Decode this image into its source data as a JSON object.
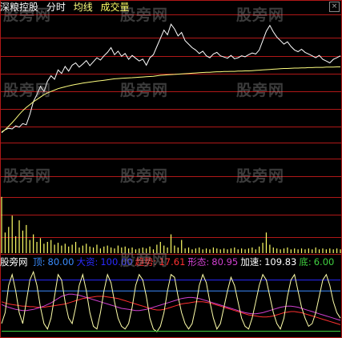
{
  "header": {
    "indicator_name": "深粮控股",
    "mode": "分时",
    "avg_label": "均线",
    "vol_label": "成交量"
  },
  "indicator": {
    "name": "股旁网",
    "items": [
      {
        "label": "顶:",
        "value": "80.00",
        "color": "#3a8cff"
      },
      {
        "label": "大资:",
        "value": "100.00",
        "color": "#2a2aff"
      },
      {
        "label": "趋势:",
        "value": "17.61",
        "color": "#ff3030"
      },
      {
        "label": "形态:",
        "value": "80.95",
        "color": "#d040d0"
      },
      {
        "label": "加速:",
        "value": "109.83",
        "color": "#ffffff"
      },
      {
        "label": "底:",
        "value": "6.00",
        "color": "#40d040"
      }
    ]
  },
  "watermark": "股旁网",
  "colors": {
    "price": "#ffffff",
    "avg": "#ffff80",
    "grid": "#b01818",
    "volume": "#ffff66",
    "topline": "#3a8cff",
    "bigline": "#2a2aff",
    "trend": "#ff3030",
    "shape": "#d040d0",
    "accel": "#ffffaa",
    "bottom": "#40d040"
  },
  "chart_data": [
    {
      "type": "line",
      "series": [
        {
          "values": [
            0.42,
            0.55,
            0.61,
            0.58,
            0.71,
            0.66,
            0.81,
            0.76,
            1.2,
            1.75,
            2.05,
            2.4,
            2.18,
            2.62,
            2.85,
            2.7,
            3.1,
            2.95,
            3.25,
            3.05,
            3.3,
            3.4,
            3.22,
            3.35,
            3.5,
            3.28,
            3.45,
            3.62,
            3.52,
            3.7,
            3.85,
            4.05,
            3.75,
            3.9,
            3.68,
            3.8,
            3.55,
            3.72,
            3.6,
            3.48,
            3.56,
            3.3,
            3.62,
            3.75,
            4.1,
            4.45,
            4.8,
            4.6,
            5.05,
            4.85,
            4.55,
            4.7,
            4.35,
            4.2,
            4.05,
            3.95,
            3.8,
            3.9,
            3.7,
            3.62,
            3.78,
            3.85,
            3.7,
            3.65,
            3.6,
            3.72,
            3.58,
            3.62,
            3.7,
            3.66,
            3.75,
            3.82,
            3.78,
            3.95,
            4.35,
            4.75,
            5.0,
            4.72,
            4.5,
            4.35,
            4.2,
            4.3,
            4.1,
            3.95,
            3.88,
            3.98,
            3.85,
            3.78,
            3.7,
            3.62,
            3.72,
            3.55,
            3.48,
            3.4,
            3.55,
            3.62,
            3.7
          ]
        },
        {
          "values": [
            0.45,
            0.55,
            0.7,
            0.85,
            1.02,
            1.2,
            1.36,
            1.5,
            1.62,
            1.74,
            1.84,
            1.94,
            2.04,
            2.12,
            2.18,
            2.24,
            2.3,
            2.34,
            2.38,
            2.42,
            2.45,
            2.48,
            2.51,
            2.54,
            2.56,
            2.58,
            2.6,
            2.62,
            2.64,
            2.66,
            2.68,
            2.7,
            2.72,
            2.73,
            2.74,
            2.75,
            2.76,
            2.77,
            2.78,
            2.79,
            2.8,
            2.81,
            2.82,
            2.83,
            2.85,
            2.87,
            2.88,
            2.89,
            2.9,
            2.91,
            2.92,
            2.93,
            2.94,
            2.95,
            2.96,
            2.97,
            2.98,
            2.99,
            3.0,
            3.0,
            3.01,
            3.02,
            3.02,
            3.03,
            3.03,
            3.04,
            3.04,
            3.05,
            3.05,
            3.06,
            3.06,
            3.07,
            3.08,
            3.09,
            3.1,
            3.11,
            3.12,
            3.13,
            3.14,
            3.15,
            3.16,
            3.16,
            3.17,
            3.18,
            3.18,
            3.19,
            3.19,
            3.2,
            3.2,
            3.21,
            3.21,
            3.21,
            3.22,
            3.22,
            3.22,
            3.23,
            3.23
          ]
        }
      ],
      "ylim": [
        0,
        5.4
      ]
    },
    {
      "type": "bar",
      "values": [
        60,
        22,
        28,
        40,
        18,
        35,
        24,
        30,
        14,
        20,
        12,
        16,
        10,
        12,
        14,
        9,
        11,
        8,
        10,
        7,
        9,
        12,
        6,
        8,
        10,
        7,
        6,
        9,
        5,
        7,
        8,
        6,
        5,
        8,
        6,
        7,
        5,
        6,
        4,
        5,
        6,
        5,
        7,
        4,
        9,
        12,
        8,
        6,
        20,
        8,
        6,
        14,
        5,
        6,
        4,
        5,
        6,
        4,
        5,
        4,
        6,
        5,
        4,
        5,
        4,
        5,
        6,
        4,
        5,
        4,
        5,
        6,
        4,
        7,
        11,
        22,
        9,
        6,
        5,
        4,
        5,
        6,
        4,
        5,
        4,
        5,
        4,
        5,
        4,
        6,
        4,
        5,
        4,
        5,
        4,
        5,
        4
      ],
      "ylim": [
        0,
        65
      ]
    },
    {
      "type": "line",
      "series": [
        {
          "values": [
            80,
            80,
            80,
            80,
            80,
            80,
            80,
            80,
            80,
            80,
            80,
            80,
            80,
            80,
            80,
            80,
            80,
            80,
            80,
            80,
            80,
            80,
            80,
            80,
            80,
            80,
            80,
            80,
            80,
            80,
            80,
            80,
            80,
            80,
            80,
            80,
            80,
            80,
            80,
            80,
            80,
            80,
            80,
            80,
            80,
            80,
            80,
            80,
            80,
            80,
            80,
            80,
            80,
            80,
            80,
            80,
            80,
            80,
            80,
            80,
            80,
            80,
            80,
            80,
            80,
            80,
            80,
            80,
            80,
            80,
            80,
            80,
            80,
            80,
            80,
            80,
            80,
            80,
            80,
            80,
            80,
            80,
            80,
            80,
            80,
            80,
            80,
            80,
            80,
            80,
            80,
            80,
            80,
            80,
            80,
            80,
            80
          ]
        },
        {
          "values": [
            100,
            100,
            100,
            100,
            100,
            100,
            100,
            100,
            100,
            100,
            100,
            100,
            100,
            100,
            100,
            100,
            100,
            100,
            100,
            100,
            100,
            100,
            100,
            100,
            100,
            100,
            100,
            100,
            100,
            100,
            100,
            100,
            100,
            100,
            100,
            100,
            100,
            100,
            100,
            100,
            100,
            100,
            100,
            100,
            100,
            100,
            100,
            100,
            100,
            100,
            100,
            100,
            100,
            100,
            100,
            100,
            100,
            100,
            100,
            100,
            100,
            100,
            100,
            100,
            100,
            100,
            100,
            100,
            100,
            100,
            100,
            100,
            100,
            100,
            100,
            100,
            100,
            100,
            100,
            100,
            100,
            100,
            100,
            100,
            100,
            100,
            100,
            100,
            100,
            100,
            100,
            100,
            100,
            100,
            100,
            100,
            100
          ]
        },
        {
          "values": [
            60,
            58,
            56,
            55,
            54,
            53,
            52,
            52,
            51,
            51,
            50,
            50,
            50,
            51,
            52,
            53,
            54,
            55,
            56,
            58,
            60,
            62,
            64,
            66,
            67,
            68,
            69,
            70,
            70,
            70,
            69,
            68,
            67,
            66,
            64,
            62,
            60,
            58,
            56,
            54,
            52,
            50,
            48,
            46,
            45,
            45,
            46,
            48,
            50,
            52,
            54,
            56,
            57,
            58,
            59,
            60,
            60,
            60,
            59,
            58,
            56,
            54,
            52,
            50,
            48,
            46,
            44,
            42,
            40,
            38,
            36,
            35,
            34,
            33,
            32,
            32,
            33,
            34,
            36,
            38,
            40,
            41,
            42,
            42,
            41,
            40,
            38,
            36,
            34,
            32,
            30,
            28,
            26,
            24,
            22,
            20,
            18
          ]
        },
        {
          "values": [
            55,
            52,
            50,
            48,
            46,
            45,
            44,
            44,
            45,
            46,
            48,
            50,
            52,
            55,
            58,
            62,
            66,
            70,
            72,
            74,
            74,
            73,
            72,
            70,
            68,
            66,
            64,
            62,
            60,
            58,
            56,
            54,
            52,
            50,
            48,
            47,
            46,
            45,
            44,
            44,
            45,
            46,
            48,
            50,
            52,
            54,
            56,
            58,
            60,
            62,
            64,
            66,
            67,
            68,
            68,
            67,
            66,
            64,
            62,
            60,
            58,
            56,
            54,
            52,
            50,
            48,
            46,
            44,
            42,
            40,
            39,
            38,
            38,
            39,
            40,
            42,
            44,
            46,
            48,
            50,
            51,
            52,
            52,
            51,
            50,
            48,
            46,
            44,
            42,
            40,
            38,
            36,
            34,
            32,
            30,
            28,
            26
          ]
        },
        {
          "values": [
            20,
            40,
            90,
            110,
            80,
            40,
            20,
            60,
            100,
            115,
            90,
            50,
            20,
            10,
            30,
            70,
            110,
            100,
            60,
            30,
            20,
            50,
            90,
            110,
            80,
            40,
            15,
            10,
            40,
            80,
            110,
            95,
            60,
            30,
            15,
            10,
            20,
            50,
            90,
            110,
            100,
            70,
            30,
            10,
            5,
            15,
            40,
            80,
            110,
            105,
            70,
            40,
            20,
            10,
            20,
            50,
            90,
            110,
            95,
            60,
            30,
            10,
            20,
            50,
            80,
            105,
            90,
            60,
            30,
            15,
            10,
            30,
            60,
            90,
            110,
            100,
            70,
            40,
            20,
            10,
            30,
            70,
            100,
            110,
            80,
            50,
            30,
            15,
            20,
            40,
            70,
            100,
            110,
            90,
            60,
            40,
            30
          ]
        },
        {
          "values": [
            6,
            6,
            6,
            6,
            6,
            6,
            6,
            6,
            6,
            6,
            6,
            6,
            6,
            6,
            6,
            6,
            6,
            6,
            6,
            6,
            6,
            6,
            6,
            6,
            6,
            6,
            6,
            6,
            6,
            6,
            6,
            6,
            6,
            6,
            6,
            6,
            6,
            6,
            6,
            6,
            6,
            6,
            6,
            6,
            6,
            6,
            6,
            6,
            6,
            6,
            6,
            6,
            6,
            6,
            6,
            6,
            6,
            6,
            6,
            6,
            6,
            6,
            6,
            6,
            6,
            6,
            6,
            6,
            6,
            6,
            6,
            6,
            6,
            6,
            6,
            6,
            6,
            6,
            6,
            6,
            6,
            6,
            6,
            6,
            6,
            6,
            6,
            6,
            6,
            6,
            6,
            6,
            6,
            6,
            6,
            6,
            6
          ]
        }
      ],
      "ylim": [
        -5,
        120
      ]
    }
  ]
}
